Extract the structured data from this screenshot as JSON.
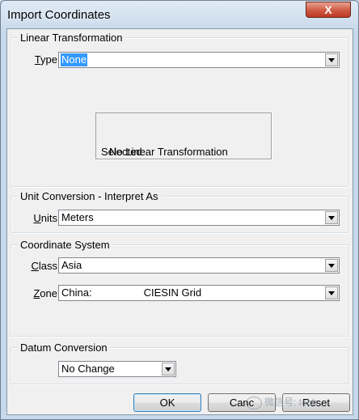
{
  "window": {
    "title": "Import Coordinates",
    "close_glyph": "X"
  },
  "linear_transformation": {
    "legend": "Linear Transformation",
    "type_label_ul": "T",
    "type_label_rest": "ype",
    "type_value": "None",
    "message_line1": "No Linear Transformation",
    "message_line2": "Selected"
  },
  "unit_conversion": {
    "legend": "Unit Conversion - Interpret As",
    "units_label_ul": "U",
    "units_label_rest": "nits",
    "units_value": "Meters"
  },
  "coordinate_system": {
    "legend": "Coordinate System",
    "class_label_ul": "C",
    "class_label_rest": "lass",
    "class_value": "Asia",
    "zone_label_ul": "Z",
    "zone_label_rest": "one",
    "zone_value_part1": "China:",
    "zone_value_part2": "CIESIN Grid"
  },
  "datum_conversion": {
    "legend": "Datum Conversion",
    "value": "No Change"
  },
  "buttons": {
    "ok": "OK",
    "cancel": "Canc",
    "reset": "Reset"
  },
  "watermark": {
    "text": "微信号: tech"
  }
}
